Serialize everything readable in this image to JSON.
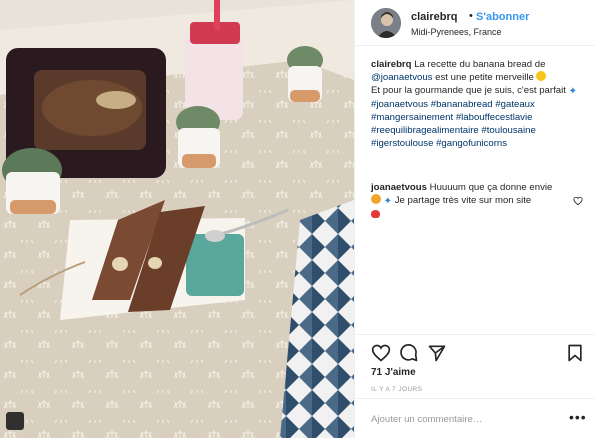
{
  "post_image": {
    "photo_icon": "carousel-icon"
  },
  "header": {
    "username": "clairebrq",
    "separator": "•",
    "follow_label": "S'abonner",
    "location": "Midi-Pyrenees, France",
    "more_icon": "more-icon"
  },
  "caption": {
    "username": "clairebrq",
    "text_before_mention": "La recette du banana bread de",
    "mention": "@joanaetvous",
    "text_after_mention": "est une petite merveille",
    "line2": "Et pour la gourmande que je suis, c'est parfait",
    "hashtags": [
      "#joanaetvous",
      "#bananabread",
      "#gateaux",
      "#mangersainement",
      "#labouffecestlavie",
      "#reequilibragealimentaire",
      "#toulousaine",
      "#igerstoulouse",
      "#gangofunicorns"
    ]
  },
  "comment": {
    "username": "joanaetvous",
    "text_part1": "Huuuum que ça donne envie",
    "text_part2": "Je partage très vite sur mon site"
  },
  "actions": {
    "like_icon": "heart-icon",
    "comment_icon": "comment-icon",
    "share_icon": "share-icon",
    "save_icon": "bookmark-icon"
  },
  "likes": "71 J'aime",
  "timestamp": "IL Y A 7 JOURS",
  "add_comment": {
    "placeholder": "Ajouter un commentaire…",
    "menu_glyph": "•••"
  }
}
